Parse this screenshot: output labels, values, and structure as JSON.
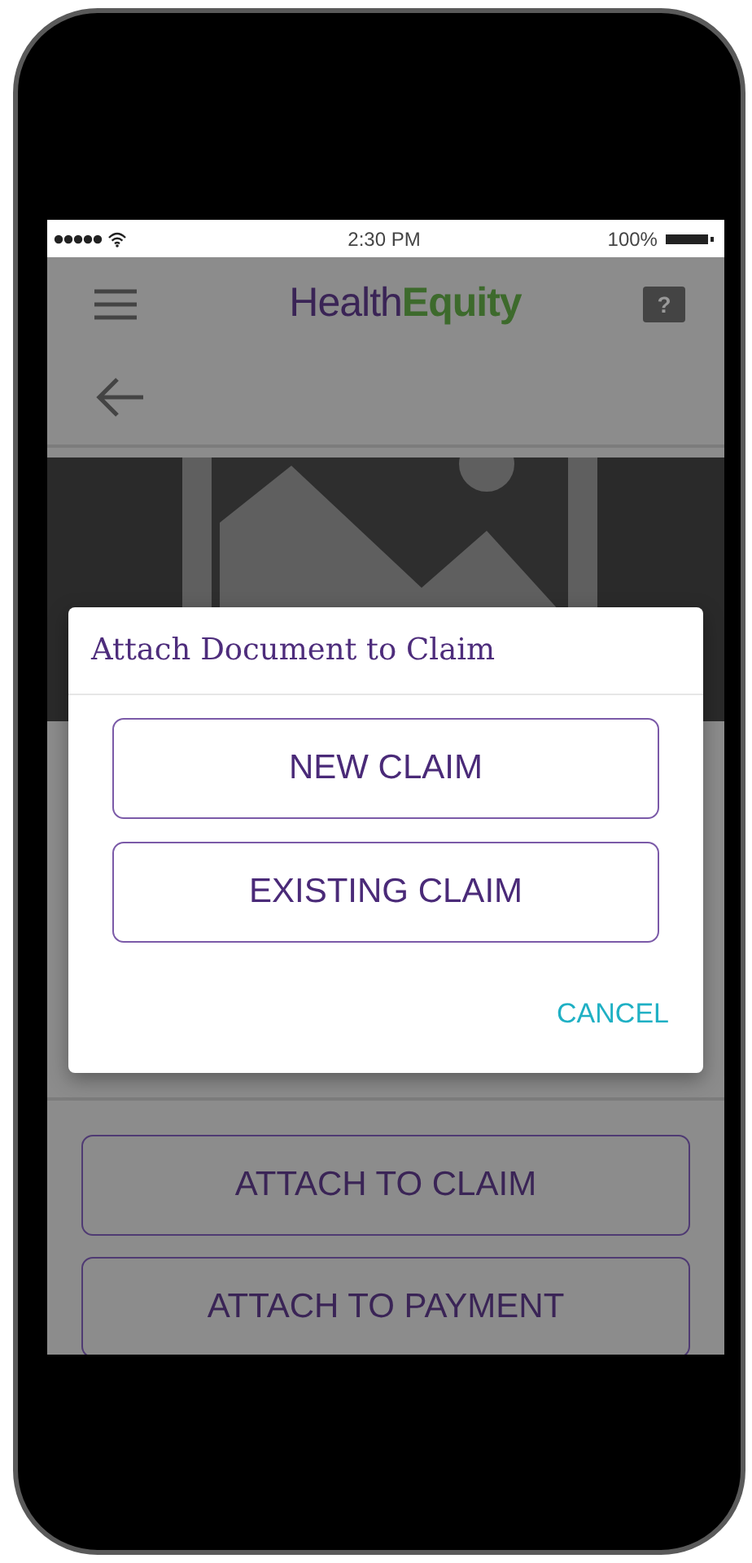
{
  "status_bar": {
    "time": "2:30 PM",
    "battery": "100%"
  },
  "app_bar": {
    "logo": {
      "part_1": "Health",
      "part_2": "Equity"
    },
    "help": "?"
  },
  "actions": [
    {
      "label": "ATTACH TO CLAIM"
    },
    {
      "label": "ATTACH TO PAYMENT"
    }
  ],
  "dialog": {
    "title": "Attach Document to Claim",
    "options": [
      {
        "label": "NEW CLAIM"
      },
      {
        "label": "EXISTING CLAIM"
      }
    ],
    "cancel": "CANCEL"
  }
}
